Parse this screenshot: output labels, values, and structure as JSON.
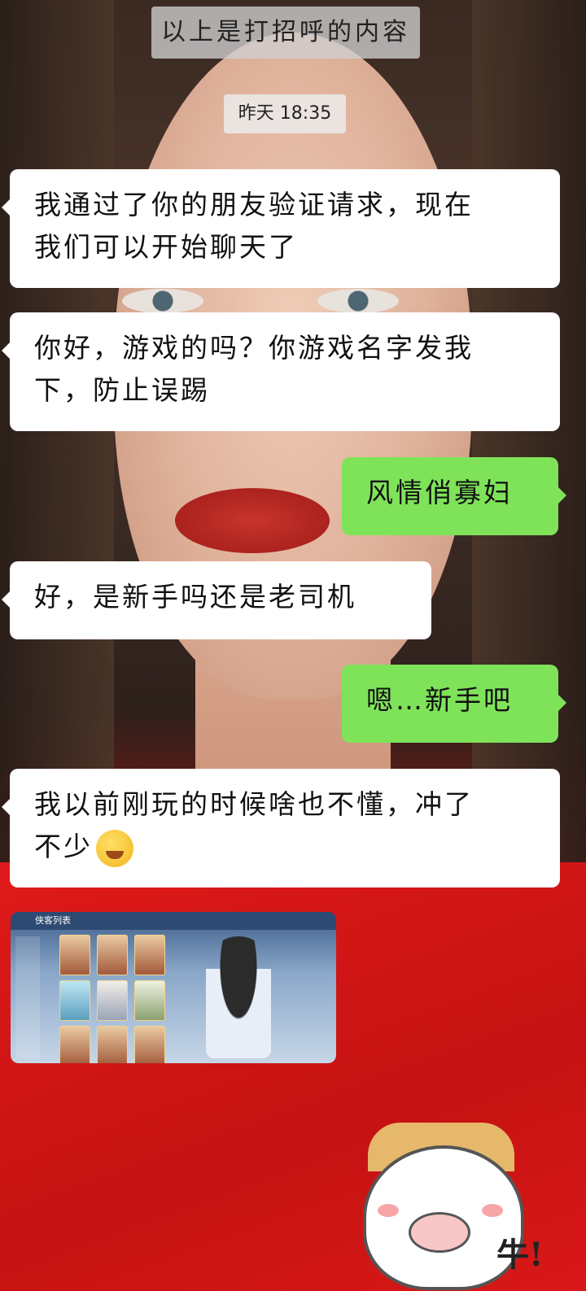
{
  "system_notice": "以上是打招呼的内容",
  "timestamp": "昨天 18:35",
  "messages": [
    {
      "side": "left",
      "lines": [
        "我通过了你的朋友验证请求，现在",
        "我们可以开始聊天了"
      ]
    },
    {
      "side": "left",
      "lines": [
        "你好，游戏的吗？你游戏名字发我",
        "下，防止误踢"
      ]
    },
    {
      "side": "right",
      "lines": [
        "风情俏寡妇"
      ]
    },
    {
      "side": "left",
      "lines": [
        "好，是新手吗还是老司机"
      ]
    },
    {
      "side": "right",
      "lines": [
        "嗯…新手吧"
      ]
    },
    {
      "side": "left",
      "lines": [
        "我以前刚玩的时候啥也不懂，冲了",
        "不少"
      ],
      "emoji": "crying-laughing-face-emoji"
    }
  ],
  "image_message": {
    "thumbnail_label": "侠客列表"
  },
  "sticker": {
    "text": "牛!",
    "icon": "cow-pig-sticker"
  },
  "colors": {
    "incoming_bubble": "#ffffff",
    "outgoing_bubble": "#7fe35a",
    "notice_bg": "#d0d0d0"
  }
}
